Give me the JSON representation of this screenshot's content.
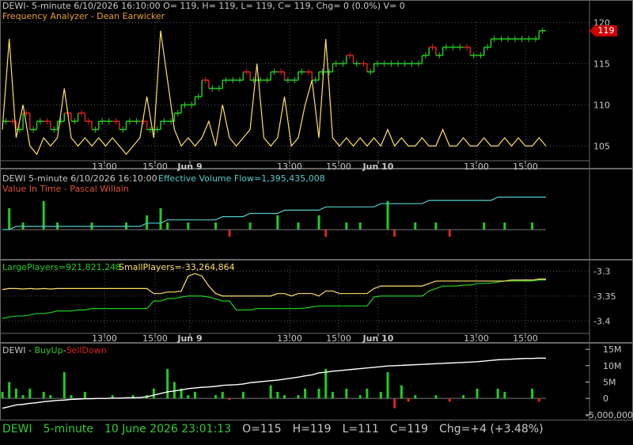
{
  "colors": {
    "green": "#22cc22",
    "red": "#dd2222",
    "yellow": "#ffe066",
    "cyan": "#55cccc",
    "white": "#ffffff",
    "grid": "#555555",
    "text": "#c8c8c8",
    "accent": "#cc0000"
  },
  "panel1": {
    "header": "DEWI- 5-minute 6/10/2026 16:10:00 O= 119, H= 119, L= 119, C= 119, Chg= 0 (0.0%) V= 0",
    "indicator": "Frequency Analyzer - Dean Earwicker",
    "last_price_tag": "119"
  },
  "panel2": {
    "header": "DEWI 5-minute  6/10/2026 16:10:00",
    "indicator_value": "Effective Volume Flow=1,395,435,008",
    "indicator2": "Value In Time - Pascal Willain"
  },
  "panel3": {
    "large_players": "LargePlayers=921,821,248",
    "small_players": "SmallPlayers=-33,264,864"
  },
  "panel4": {
    "prefix": "DEWI - ",
    "buy_up": "BuyUp",
    "sep": "-",
    "sell_down": "SellDown"
  },
  "status": {
    "symbol": "DEWI",
    "interval": "5-minute",
    "datetime": "10 June 2026 23:01:13",
    "open": "O=115",
    "high": "H=119",
    "low": "L=111",
    "close": "C=119",
    "change": "Chg=+4 (+3.48%)"
  },
  "chart_data": [
    {
      "type": "line",
      "name": "price-panel",
      "x_ticks": [
        "13:00",
        "15:00",
        "Jun 9",
        "13:00",
        "15:00",
        "Jun 10",
        "13:00",
        "15:00"
      ],
      "y_ticks": [
        105,
        110,
        115,
        120
      ],
      "ylim": [
        103.5,
        121
      ],
      "series": [
        {
          "role": "price-steps",
          "color_note": "green up / red down",
          "values": [
            108,
            108,
            107,
            109,
            107,
            108,
            108,
            107,
            108,
            109,
            108,
            109,
            108,
            107,
            108,
            108,
            108,
            107,
            108,
            108,
            108,
            107,
            107,
            108,
            108,
            109,
            110,
            110,
            111,
            113,
            112,
            112,
            113,
            113,
            113,
            114,
            113,
            113,
            113,
            114,
            114,
            113,
            113,
            114,
            114,
            113,
            114,
            114,
            115,
            115,
            116,
            115,
            115,
            114,
            115,
            115,
            115,
            115,
            115,
            115,
            115,
            116,
            117,
            116,
            117,
            117,
            117,
            117,
            116,
            116,
            117,
            118,
            118,
            118,
            118,
            118,
            118,
            118,
            119,
            119
          ]
        },
        {
          "role": "frequency-analyzer",
          "color_note": "yellow",
          "values": [
            107,
            118,
            106,
            110,
            105,
            104,
            106,
            105,
            106,
            112,
            106,
            105,
            106,
            105,
            106,
            105,
            106,
            105,
            104,
            105,
            106,
            111,
            106,
            119,
            113,
            107,
            105,
            106,
            105,
            106,
            108,
            105,
            110,
            106,
            105,
            106,
            107,
            115,
            106,
            105,
            106,
            111,
            105,
            106,
            110,
            113,
            106,
            118,
            106,
            105,
            106,
            105,
            106,
            105,
            106,
            105,
            107,
            105,
            106,
            105,
            105,
            106,
            105,
            105,
            107,
            105,
            105,
            106,
            105,
            105,
            106,
            105,
            105,
            106,
            105,
            106,
            105,
            105,
            106,
            105
          ]
        }
      ]
    },
    {
      "type": "line",
      "name": "volume-flow-panel",
      "series": [
        {
          "role": "effective-volume-flow",
          "color_note": "cyan",
          "values": [
            0,
            0,
            1,
            1,
            1,
            1,
            1,
            1,
            1,
            1,
            1,
            1,
            1,
            1,
            1,
            1,
            1,
            1,
            1,
            1,
            1,
            2,
            2,
            2,
            3,
            3,
            3,
            3,
            3,
            3,
            3,
            3,
            4,
            4,
            4,
            4,
            5,
            5,
            5,
            5,
            5,
            6,
            6,
            6,
            6,
            6,
            6,
            7,
            7,
            7,
            7,
            7,
            7,
            7,
            7,
            8,
            8,
            8,
            8,
            8,
            8,
            8,
            9,
            9,
            9,
            9,
            9,
            9,
            9,
            9,
            9,
            9,
            10,
            10,
            10,
            10,
            10,
            10,
            10,
            10
          ]
        }
      ],
      "bars": [
        0,
        3,
        0,
        1,
        0,
        0,
        4,
        0,
        1,
        0,
        0,
        0,
        0,
        1,
        0,
        0,
        0,
        0,
        1,
        0,
        0,
        2,
        0,
        3,
        1,
        0,
        0,
        1,
        0,
        0,
        0,
        1,
        0,
        -1,
        0,
        0,
        1,
        0,
        0,
        0,
        2,
        0,
        0,
        1,
        0,
        0,
        2,
        -1,
        0,
        0,
        1,
        0,
        1,
        0,
        0,
        0,
        4,
        -1,
        0,
        0,
        1,
        0,
        0,
        1,
        0,
        -1,
        0,
        0,
        0,
        0,
        1,
        0,
        0,
        1,
        0,
        0,
        0,
        1,
        0,
        0
      ]
    },
    {
      "type": "line",
      "name": "players-panel",
      "y_ticks": [
        -3.3,
        -3.35,
        -3.4
      ],
      "series": [
        {
          "role": "large-players",
          "color_note": "green",
          "values": [
            -3.395,
            -3.392,
            -3.39,
            -3.39,
            -3.388,
            -3.385,
            -3.385,
            -3.383,
            -3.38,
            -3.38,
            -3.38,
            -3.378,
            -3.378,
            -3.375,
            -3.375,
            -3.375,
            -3.375,
            -3.375,
            -3.375,
            -3.375,
            -3.375,
            -3.375,
            -3.36,
            -3.36,
            -3.355,
            -3.355,
            -3.352,
            -3.35,
            -3.35,
            -3.35,
            -3.352,
            -3.356,
            -3.36,
            -3.36,
            -3.378,
            -3.378,
            -3.378,
            -3.375,
            -3.375,
            -3.375,
            -3.375,
            -3.375,
            -3.375,
            -3.375,
            -3.374,
            -3.372,
            -3.37,
            -3.37,
            -3.37,
            -3.37,
            -3.37,
            -3.37,
            -3.37,
            -3.37,
            -3.352,
            -3.35,
            -3.35,
            -3.35,
            -3.35,
            -3.35,
            -3.35,
            -3.35,
            -3.34,
            -3.335,
            -3.33,
            -3.33,
            -3.33,
            -3.328,
            -3.328,
            -3.325,
            -3.325,
            -3.324,
            -3.322,
            -3.32,
            -3.32,
            -3.32,
            -3.32,
            -3.32,
            -3.318,
            -3.318
          ]
        },
        {
          "role": "small-players",
          "color_note": "yellow",
          "values": [
            -3.337,
            -3.335,
            -3.335,
            -3.336,
            -3.335,
            -3.336,
            -3.335,
            -3.336,
            -3.335,
            -3.335,
            -3.335,
            -3.335,
            -3.335,
            -3.335,
            -3.335,
            -3.335,
            -3.335,
            -3.335,
            -3.335,
            -3.335,
            -3.335,
            -3.335,
            -3.345,
            -3.345,
            -3.342,
            -3.342,
            -3.34,
            -3.31,
            -3.305,
            -3.31,
            -3.33,
            -3.345,
            -3.35,
            -3.35,
            -3.35,
            -3.35,
            -3.35,
            -3.35,
            -3.35,
            -3.35,
            -3.345,
            -3.345,
            -3.35,
            -3.345,
            -3.345,
            -3.345,
            -3.35,
            -3.34,
            -3.34,
            -3.345,
            -3.345,
            -3.345,
            -3.345,
            -3.345,
            -3.335,
            -3.33,
            -3.33,
            -3.33,
            -3.33,
            -3.33,
            -3.33,
            -3.33,
            -3.325,
            -3.32,
            -3.32,
            -3.32,
            -3.32,
            -3.32,
            -3.32,
            -3.32,
            -3.32,
            -3.32,
            -3.32,
            -3.32,
            -3.318,
            -3.318,
            -3.318,
            -3.318,
            -3.316,
            -3.316
          ]
        }
      ]
    },
    {
      "type": "bar",
      "name": "buyup-selldown-panel",
      "y_ticks": [
        "15M",
        "10M",
        "5M",
        "0",
        "-5,000,000"
      ],
      "ylim": [
        -6000000,
        16000000
      ],
      "series": [
        {
          "role": "cumulative",
          "color_note": "white",
          "values": [
            -3000000,
            -2500000,
            -2000000,
            -1800000,
            -1500000,
            -1300000,
            -1000000,
            -800000,
            -600000,
            -500000,
            -300000,
            -200000,
            -100000,
            -100000,
            0,
            0,
            100000,
            100000,
            200000,
            200000,
            300000,
            500000,
            1000000,
            1500000,
            2000000,
            2300000,
            2600000,
            3000000,
            3200000,
            3400000,
            3500000,
            3700000,
            4000000,
            4100000,
            4200000,
            4400000,
            4800000,
            5000000,
            5200000,
            5400000,
            5600000,
            5900000,
            6200000,
            6500000,
            6900000,
            7200000,
            7800000,
            8000000,
            8300000,
            8500000,
            8700000,
            8900000,
            9100000,
            9300000,
            9500000,
            9700000,
            9900000,
            10000000,
            10100000,
            10200000,
            10300000,
            10400000,
            10500000,
            10600000,
            10700000,
            10800000,
            10900000,
            11000000,
            11100000,
            11200000,
            11400000,
            11600000,
            11800000,
            11900000,
            12000000,
            12100000,
            12200000,
            12200000,
            12300000,
            12300000
          ]
        }
      ],
      "bars": [
        2000000,
        5000000,
        3000000,
        1000000,
        3000000,
        0,
        2000000,
        1000000,
        0,
        8000000,
        1000000,
        0,
        2000000,
        0,
        0,
        0,
        1000000,
        0,
        0,
        1000000,
        0,
        1000000,
        3000000,
        0,
        9000000,
        5000000,
        3000000,
        1000000,
        2000000,
        0,
        0,
        1000000,
        2000000,
        -500000,
        0,
        2000000,
        0,
        0,
        0,
        4000000,
        2000000,
        1000000,
        0,
        1000000,
        3000000,
        0,
        3000000,
        9000000,
        2000000,
        0,
        3000000,
        0,
        1000000,
        3000000,
        0,
        2000000,
        8000000,
        -3000000,
        4000000,
        -1000000,
        1000000,
        0,
        0,
        1000000,
        0,
        -1000000,
        0,
        1000000,
        0,
        3000000,
        0,
        0,
        3000000,
        2000000,
        0,
        0,
        0,
        3000000,
        -1000000,
        0
      ]
    }
  ]
}
